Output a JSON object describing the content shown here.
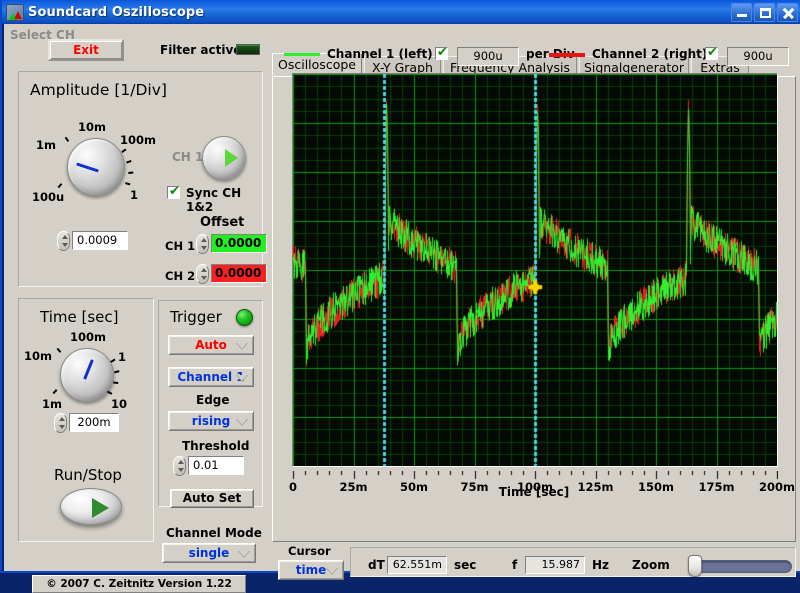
{
  "window": {
    "title": "Soundcard Oszilloscope",
    "icon": "scope-icon",
    "buttons": {
      "minimize": "minimize-icon",
      "maximize": "maximize-icon",
      "close": "close-icon"
    }
  },
  "toolbar": {
    "exit_label": "Exit",
    "filter_label": "Filter active",
    "filter_led": "off"
  },
  "amplitude": {
    "title": "Amplitude [1/Div]",
    "knob_labels": [
      "10m",
      "100m",
      "1",
      "100u",
      "1m"
    ],
    "value": "0.0009",
    "select_ch_title": "Select CH",
    "select_ch_value": "CH 1",
    "sync_label": "Sync CH 1&2",
    "sync_checked": true,
    "offset_title": "Offset",
    "offsets": [
      {
        "label": "CH 1",
        "value": "0.0000",
        "color": "#22ee22"
      },
      {
        "label": "CH 2",
        "value": "0.0000",
        "color": "#f82020"
      }
    ]
  },
  "time": {
    "title": "Time [sec]",
    "knob_labels": [
      "100m",
      "1",
      "10",
      "1m",
      "10m"
    ],
    "value": "200m"
  },
  "trigger": {
    "title": "Trigger",
    "led": "on",
    "mode": "Auto",
    "source": "Channel 1",
    "edge_label": "Edge",
    "edge": "rising",
    "threshold_label": "Threshold",
    "threshold": "0.01",
    "autoset_label": "Auto Set"
  },
  "runstop": {
    "label": "Run/Stop"
  },
  "channel_mode": {
    "label": "Channel Mode",
    "value": "single"
  },
  "copyright": "© 2007   C. Zeitnitz Version 1.22",
  "tabs": [
    {
      "label": "Oscilloscope",
      "active": true
    },
    {
      "label": "X-Y Graph",
      "active": false
    },
    {
      "label": "Frequency Analysis",
      "active": false
    },
    {
      "label": "Signalgenerator",
      "active": false
    },
    {
      "label": "Extras",
      "active": false
    }
  ],
  "channels": [
    {
      "name": "Channel 1 (left)",
      "color": "#00e000",
      "enabled": true,
      "per_div": "900u",
      "per_div_label": "per Div"
    },
    {
      "name": "Channel 2 (right)",
      "color": "#ee1111",
      "enabled": true,
      "per_div": "900u",
      "per_div_label": "per Div"
    }
  ],
  "cursor": {
    "label": "Cursor",
    "mode": "time",
    "dt_label": "dT",
    "dt_value": "62.551m",
    "dt_unit": "sec",
    "f_label": "f",
    "f_value": "15.987",
    "f_unit": "Hz",
    "zoom_label": "Zoom",
    "zoom_value": 0
  },
  "chart_data": {
    "type": "line",
    "title": "",
    "xlabel": "Time [sec]",
    "ylabel": "",
    "xlim": [
      0,
      0.2
    ],
    "xtick_labels": [
      "0",
      "25m",
      "50m",
      "75m",
      "100m",
      "125m",
      "150m",
      "175m",
      "200m"
    ],
    "xticks": [
      0,
      0.025,
      0.05,
      0.075,
      0.1,
      0.125,
      0.15,
      0.175,
      0.2
    ],
    "ylim": [
      -4,
      4
    ],
    "grid": true,
    "grid_color": "#0b9b0b",
    "minor_grid_color": "#063f06",
    "background": "#030903",
    "legend_position": "top",
    "cursors": [
      {
        "name": "cursor-1",
        "x": 0.0375,
        "color": "#45d8e8",
        "style": "dotted"
      },
      {
        "name": "cursor-2",
        "x": 0.1001,
        "color": "#45d8e8",
        "style": "dotted"
      }
    ],
    "cursor_marker": {
      "x": 0.1001,
      "y": -0.35,
      "color": "#ffd400"
    },
    "series": [
      {
        "name": "Channel 1 (left)",
        "color": "#2ef02e",
        "noise": 0.22
      },
      {
        "name": "Channel 2 (right)",
        "color": "#ee2020",
        "noise": 0.22
      }
    ],
    "waveform": {
      "shape": "sawtooth-ramp-with-spike",
      "period": 0.0625,
      "phase": 0.0375,
      "ramp_low": -1.65,
      "ramp_high": -0.15,
      "spike_peak": 3.35,
      "decay_start": 1.05,
      "decay_end": 0.05,
      "cycles": 3.2
    }
  }
}
